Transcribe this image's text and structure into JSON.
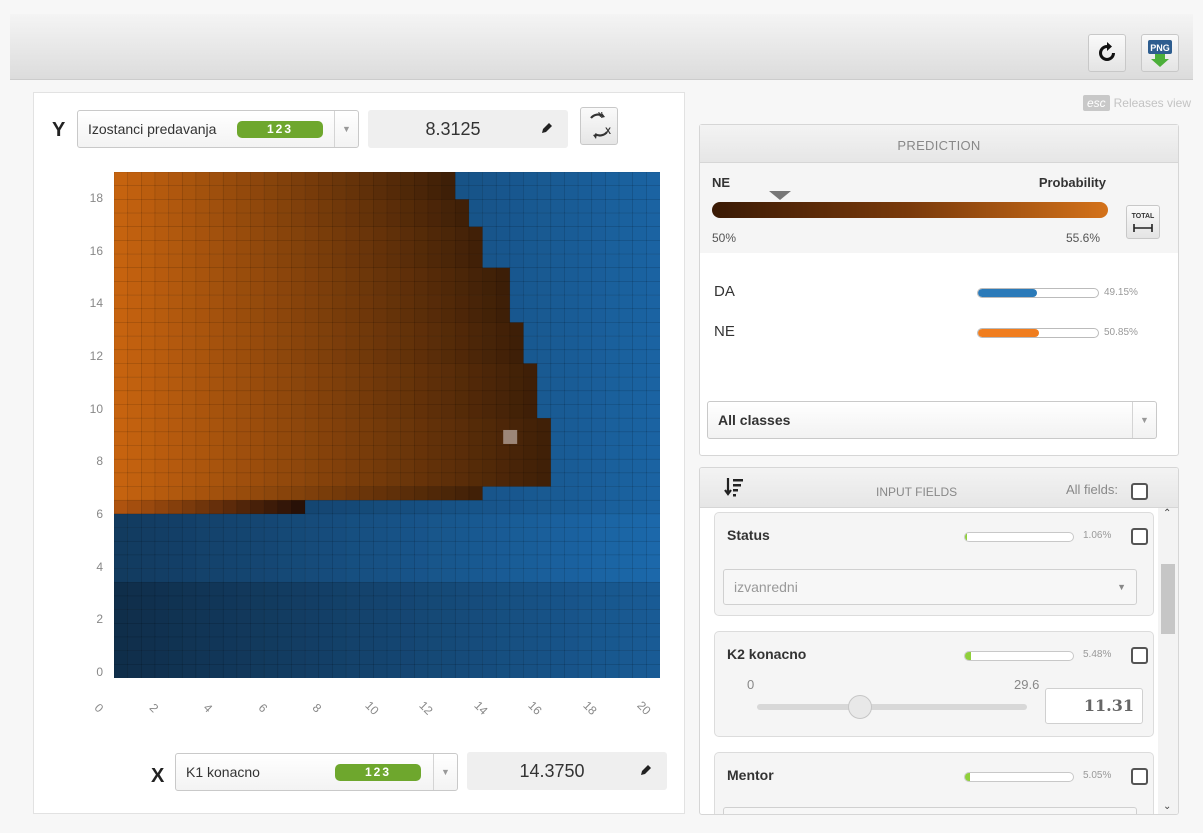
{
  "toolbar": {
    "refresh_icon": "refresh-icon",
    "png_label": "PNG"
  },
  "y_axis": {
    "letter": "Y",
    "field": "Izostanci predavanja",
    "type_badge": "123",
    "value": "8.3125"
  },
  "x_axis": {
    "letter": "X",
    "field": "K1 konacno",
    "type_badge": "123",
    "value": "14.3750"
  },
  "plot": {
    "y_ticks": [
      "18",
      "16",
      "14",
      "12",
      "10",
      "8",
      "6",
      "4",
      "2",
      "0"
    ],
    "x_ticks": [
      "0",
      "2",
      "4",
      "6",
      "8",
      "10",
      "12",
      "14",
      "16",
      "18",
      "20"
    ],
    "colors": {
      "class_ne": "#c8640f",
      "class_da": "#1a6fb0"
    }
  },
  "releases": {
    "esc": "esc",
    "text": "Releases view"
  },
  "prediction": {
    "title": "PREDICTION",
    "predicted_class": "NE",
    "probability_label": "Probability",
    "range_min": "50%",
    "range_max": "55.6%",
    "marker_value": 50.85,
    "total_label": "TOTAL",
    "classes": [
      {
        "name": "DA",
        "pct_label": "49.15%",
        "value": 49.15,
        "color": "#2a7ab9"
      },
      {
        "name": "NE",
        "pct_label": "50.85%",
        "value": 50.85,
        "color": "#f07d1e"
      }
    ],
    "filter": "All classes"
  },
  "input_fields": {
    "title": "INPUT FIELDS",
    "all_fields_label": "All fields:",
    "fields": [
      {
        "name": "Status",
        "importance_label": "1.06%",
        "importance": 1.06,
        "select_value": "izvanredni"
      },
      {
        "name": "K2 konacno",
        "importance_label": "5.48%",
        "importance": 5.48,
        "min": "0",
        "max": "29.6",
        "value": "11.31",
        "slider_fraction": 0.38
      },
      {
        "name": "Mentor",
        "importance_label": "5.05%",
        "importance": 5.05
      }
    ]
  }
}
